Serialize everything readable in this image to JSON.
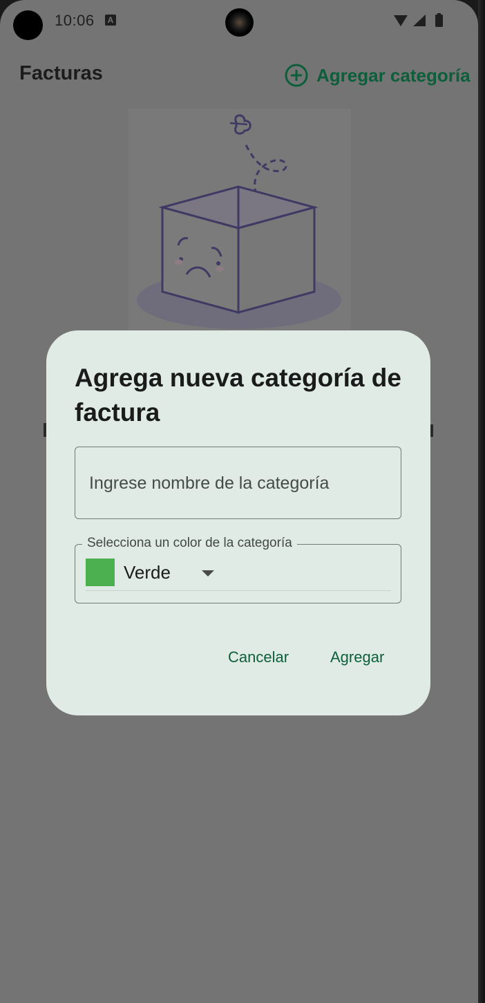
{
  "status_bar": {
    "time": "10:06",
    "notification_icon": "a-notification-icon",
    "icons": [
      "wifi-icon",
      "signal-icon",
      "battery-icon"
    ]
  },
  "app_bar": {
    "title": "Facturas",
    "add_category_label": "Agregar categoría",
    "add_category_icon": "plus-circle-icon"
  },
  "empty_state": {
    "illustration": "sad-empty-box-illustration"
  },
  "dialog": {
    "title": "Agrega nueva categoría de factura",
    "name_field": {
      "placeholder": "Ingrese nombre de la categoría",
      "value": ""
    },
    "color_field": {
      "label": "Selecciona un color de la categoría",
      "selected_value": "Verde",
      "selected_color": "#4caf50"
    },
    "cancel_label": "Cancelar",
    "add_label": "Agregar"
  },
  "colors": {
    "accent": "#0d5f3b",
    "scrim": "#747474",
    "dialog_bg": "#e1ebe6",
    "illustration_stroke": "#3f3a63"
  }
}
